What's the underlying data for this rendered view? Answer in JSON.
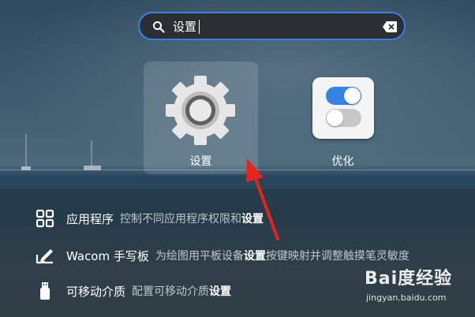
{
  "search": {
    "query": "设置",
    "search_icon": "search-icon",
    "clear_icon": "clear-text-icon"
  },
  "apps": [
    {
      "label": "设置",
      "icon": "settings-gear-icon",
      "selected": true
    },
    {
      "label": "优化",
      "icon": "tweaks-toggle-icon",
      "selected": false
    }
  ],
  "results": [
    {
      "icon": "grid-apps-icon",
      "name": "应用程序",
      "desc_before": "控制不同应用程序权限和",
      "desc_bold": "设置",
      "desc_after": ""
    },
    {
      "icon": "tablet-pen-icon",
      "name": "Wacom 手写板",
      "desc_before": "为绘图用平板设备",
      "desc_bold": "设置",
      "desc_after": "按键映射并调整触摸笔灵敏度"
    },
    {
      "icon": "usb-drive-icon",
      "name": "可移动介质",
      "desc_before": "配置可移动介质",
      "desc_bold": "设置",
      "desc_after": ""
    }
  ],
  "watermark": {
    "main": "Bai度经验",
    "sub": "jingyan.baidu.com"
  },
  "colors": {
    "accent": "#3584e4",
    "arrow": "#e8231b"
  }
}
